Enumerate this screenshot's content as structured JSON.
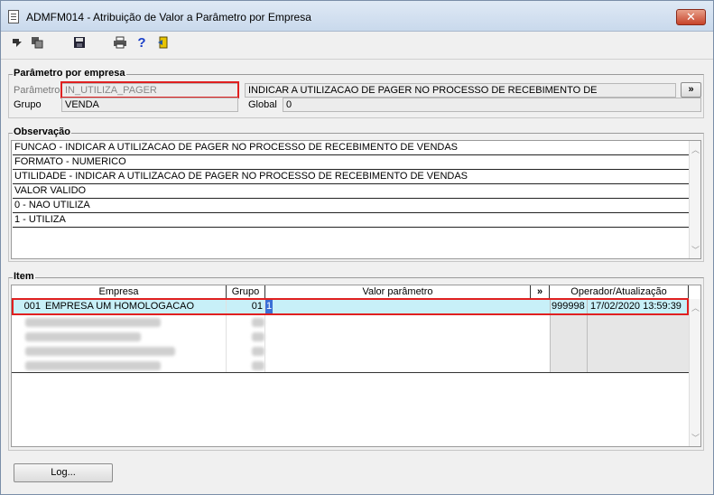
{
  "window": {
    "title": "ADMFM014 - Atribuição de Valor a Parâmetro por Empresa",
    "close_label": "✕"
  },
  "toolbar": {
    "icons": [
      "first-icon",
      "copy-icon",
      "save-icon",
      "print-icon",
      "help-icon",
      "exit-icon"
    ]
  },
  "param_section": {
    "legend": "Parâmetro por empresa",
    "parametro_label": "Parâmetro",
    "parametro_value": "IN_UTILIZA_PAGER",
    "descricao_value": "INDICAR  A UTILIZACAO DE PAGER NO PROCESSO DE RECEBIMENTO DE",
    "expand_label": "»",
    "grupo_label": "Grupo",
    "grupo_value": "VENDA",
    "global_label": "Global",
    "global_value": "0"
  },
  "observacao": {
    "legend": "Observação",
    "lines": [
      "FUNCAO - INDICAR  A UTILIZACAO DE PAGER NO PROCESSO DE RECEBIMENTO DE VENDAS",
      "FORMATO - NUMERICO",
      "UTILIDADE - INDICAR A UTILIZACAO DE PAGER NO PROCESSO DE RECEBIMENTO DE VENDAS",
      "VALOR VALIDO",
      "0 - NAO UTILIZA",
      "1 - UTILIZA"
    ]
  },
  "item": {
    "legend": "Item",
    "headers": {
      "empresa": "Empresa",
      "grupo": "Grupo",
      "valor": "Valor parâmetro",
      "expand": "»",
      "operador": "Operador/Atualização"
    },
    "rows": [
      {
        "codigo": "001",
        "empresa": "EMPRESA UM  HOMOLOGACAO",
        "grupo": "01",
        "valor": "1",
        "operador": "999998",
        "atualizacao": "17/02/2020 13:59:39"
      }
    ]
  },
  "footer": {
    "log_label": "Log..."
  }
}
